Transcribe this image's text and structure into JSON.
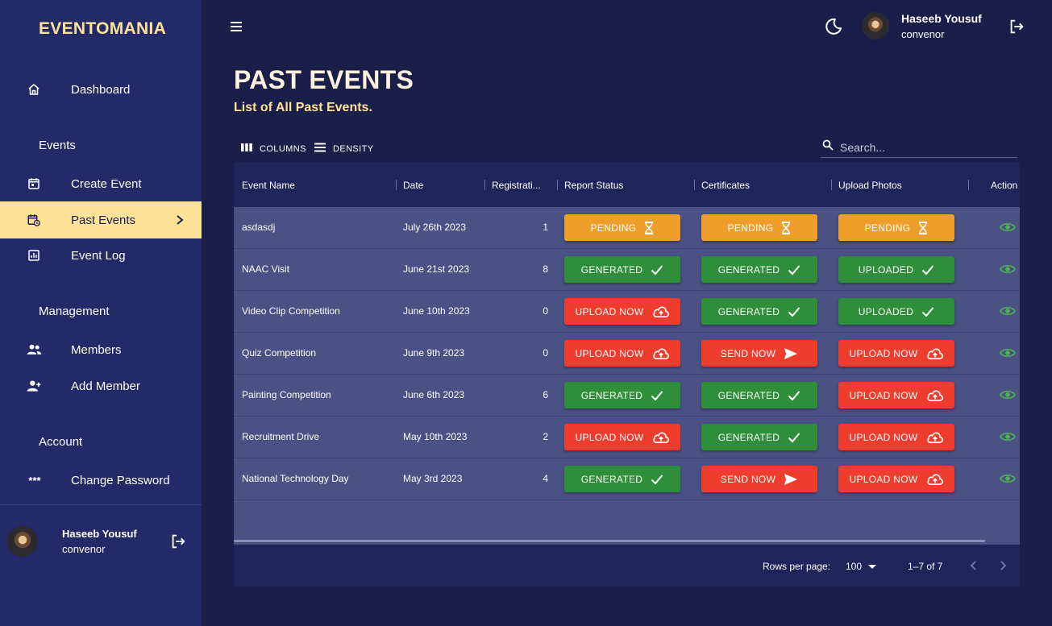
{
  "brand": "EVENTOMANIA",
  "sidebar": {
    "dashboard": "Dashboard",
    "events_title": "Events",
    "create_event": "Create Event",
    "past_events": "Past Events",
    "event_log": "Event Log",
    "management_title": "Management",
    "members": "Members",
    "add_member": "Add Member",
    "account_title": "Account",
    "change_password": "Change Password",
    "password_icon_glyph": "***",
    "user_name": "Haseeb Yousuf",
    "user_role": "convenor"
  },
  "topbar": {
    "user_name": "Haseeb Yousuf",
    "user_role": "convenor"
  },
  "page": {
    "title": "PAST EVENTS",
    "subtitle": "List of All Past Events."
  },
  "toolbar": {
    "columns": "COLUMNS",
    "density": "DENSITY",
    "search_placeholder": "Search..."
  },
  "table": {
    "headers": {
      "name": "Event Name",
      "date": "Date",
      "reg": "Registrati...",
      "report": "Report Status",
      "cert": "Certificates",
      "photos": "Upload Photos",
      "action": "Action"
    },
    "rows": [
      {
        "name": "asdasdj",
        "date": "July 26th 2023",
        "reg": "1",
        "report": "PENDING",
        "cert": "PENDING",
        "photos": "PENDING"
      },
      {
        "name": "NAAC Visit",
        "date": "June 21st 2023",
        "reg": "8",
        "report": "GENERATED",
        "cert": "GENERATED",
        "photos": "UPLOADED"
      },
      {
        "name": "Video Clip Competition",
        "date": "June 10th 2023",
        "reg": "0",
        "report": "UPLOAD NOW",
        "cert": "GENERATED",
        "photos": "UPLOADED"
      },
      {
        "name": "Quiz Competition",
        "date": "June 9th 2023",
        "reg": "0",
        "report": "UPLOAD NOW",
        "cert": "SEND NOW",
        "photos": "UPLOAD NOW"
      },
      {
        "name": "Painting Competition",
        "date": "June 6th 2023",
        "reg": "6",
        "report": "GENERATED",
        "cert": "GENERATED",
        "photos": "UPLOAD NOW"
      },
      {
        "name": "Recruitment Drive",
        "date": "May 10th 2023",
        "reg": "2",
        "report": "UPLOAD NOW",
        "cert": "GENERATED",
        "photos": "UPLOAD NOW"
      },
      {
        "name": "National Technology Day",
        "date": "May 3rd 2023",
        "reg": "4",
        "report": "GENERATED",
        "cert": "SEND NOW",
        "photos": "UPLOAD NOW"
      }
    ],
    "footer": {
      "rows_per_page_label": "Rows per page:",
      "rows_per_page": "100",
      "range": "1–7 of 7"
    }
  },
  "colors": {
    "pending": "#ef9d2b",
    "ok": "#2f8e3a",
    "warn": "#ef3d2d",
    "accent": "#ffe29a",
    "sidebar": "#232a68",
    "background": "#1a1f4a"
  }
}
